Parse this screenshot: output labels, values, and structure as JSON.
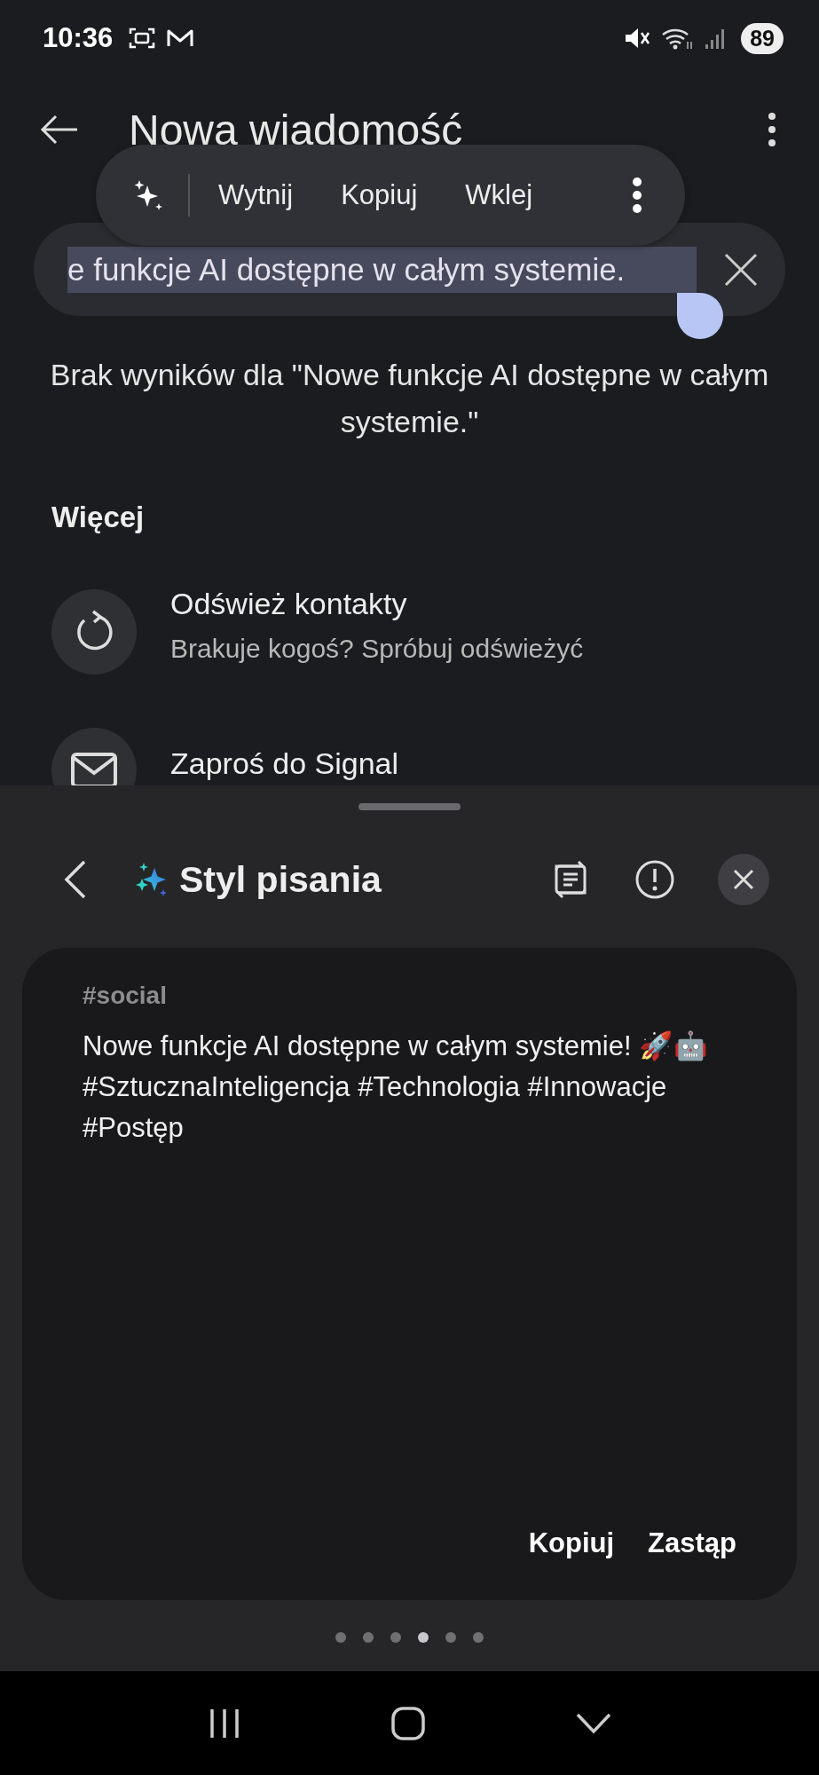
{
  "status_bar": {
    "time": "10:36",
    "battery": "89"
  },
  "header": {
    "title": "Nowa wiadomość"
  },
  "text_menu": {
    "items": [
      {
        "kind": "icon"
      },
      {
        "kind": "text",
        "label": "Wytnij"
      },
      {
        "kind": "text",
        "label": "Kopiuj"
      },
      {
        "kind": "text",
        "label": "Wklej"
      },
      {
        "kind": "more"
      }
    ]
  },
  "search": {
    "value": "e funkcje AI dostępne w całym systemie.",
    "text_selected": true
  },
  "no_results": "Brak wyników dla \"Nowe funkcje AI dostępne w całym systemie.\"",
  "section_title": "Więcej",
  "actions": [
    {
      "kind": "refresh",
      "title": "Odśwież kontakty",
      "subtitle": "Brakuje kogoś? Spróbuj odświeżyć"
    },
    {
      "kind": "invite",
      "title": "Zaproś do Signal"
    }
  ],
  "sheet": {
    "title": "Styl pisania",
    "tag": "#social",
    "text": "Nowe funkcje AI dostępne w całym systemie! 🚀🤖 #SztucznaInteligencja #Technologia #Innowacje #Postęp",
    "buttons": [
      "Kopiuj",
      "Zastąp"
    ],
    "pages": [
      {
        "selected": false
      },
      {
        "selected": false
      },
      {
        "selected": false
      },
      {
        "selected": true
      },
      {
        "selected": false
      },
      {
        "selected": false
      }
    ]
  }
}
